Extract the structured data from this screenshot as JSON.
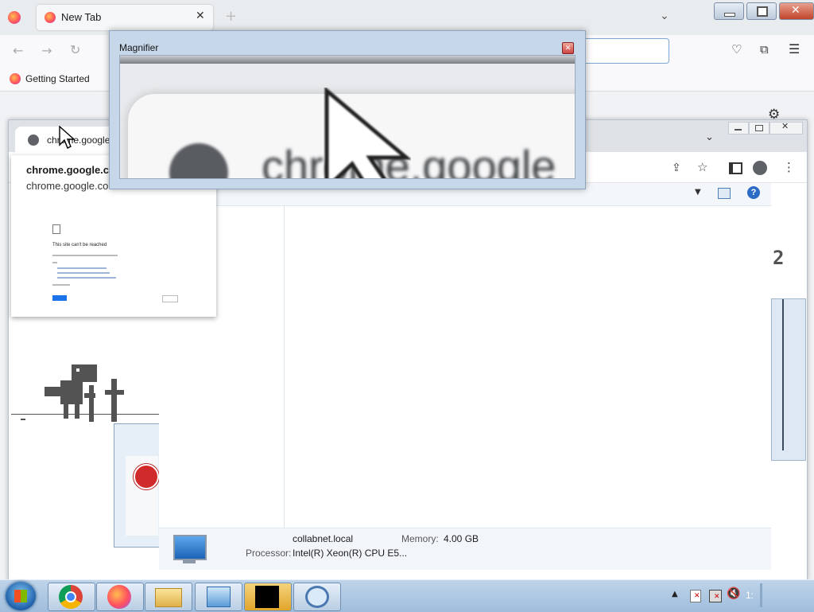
{
  "firefox": {
    "tab_title": "New Tab",
    "new_tab_symbol": "+",
    "bookmark_label": "Getting Started"
  },
  "chrome": {
    "tab_title": "chrome.google.com",
    "preview_title": "chrome.google.com",
    "preview_url": "chrome.google.com",
    "preview_heading": "This site can't be reached",
    "dino_score": "2"
  },
  "control_panel": {
    "computer_name": "collabnet.local",
    "memory_label": "Memory:",
    "memory_value": "4.00 GB",
    "processor_label": "Processor:",
    "processor_value": "Intel(R) Xeon(R) CPU E5..."
  },
  "magnifier": {
    "title": "Magnifier",
    "zoomed_text": "chrome.google"
  },
  "taskbar": {
    "clock": "1:"
  }
}
